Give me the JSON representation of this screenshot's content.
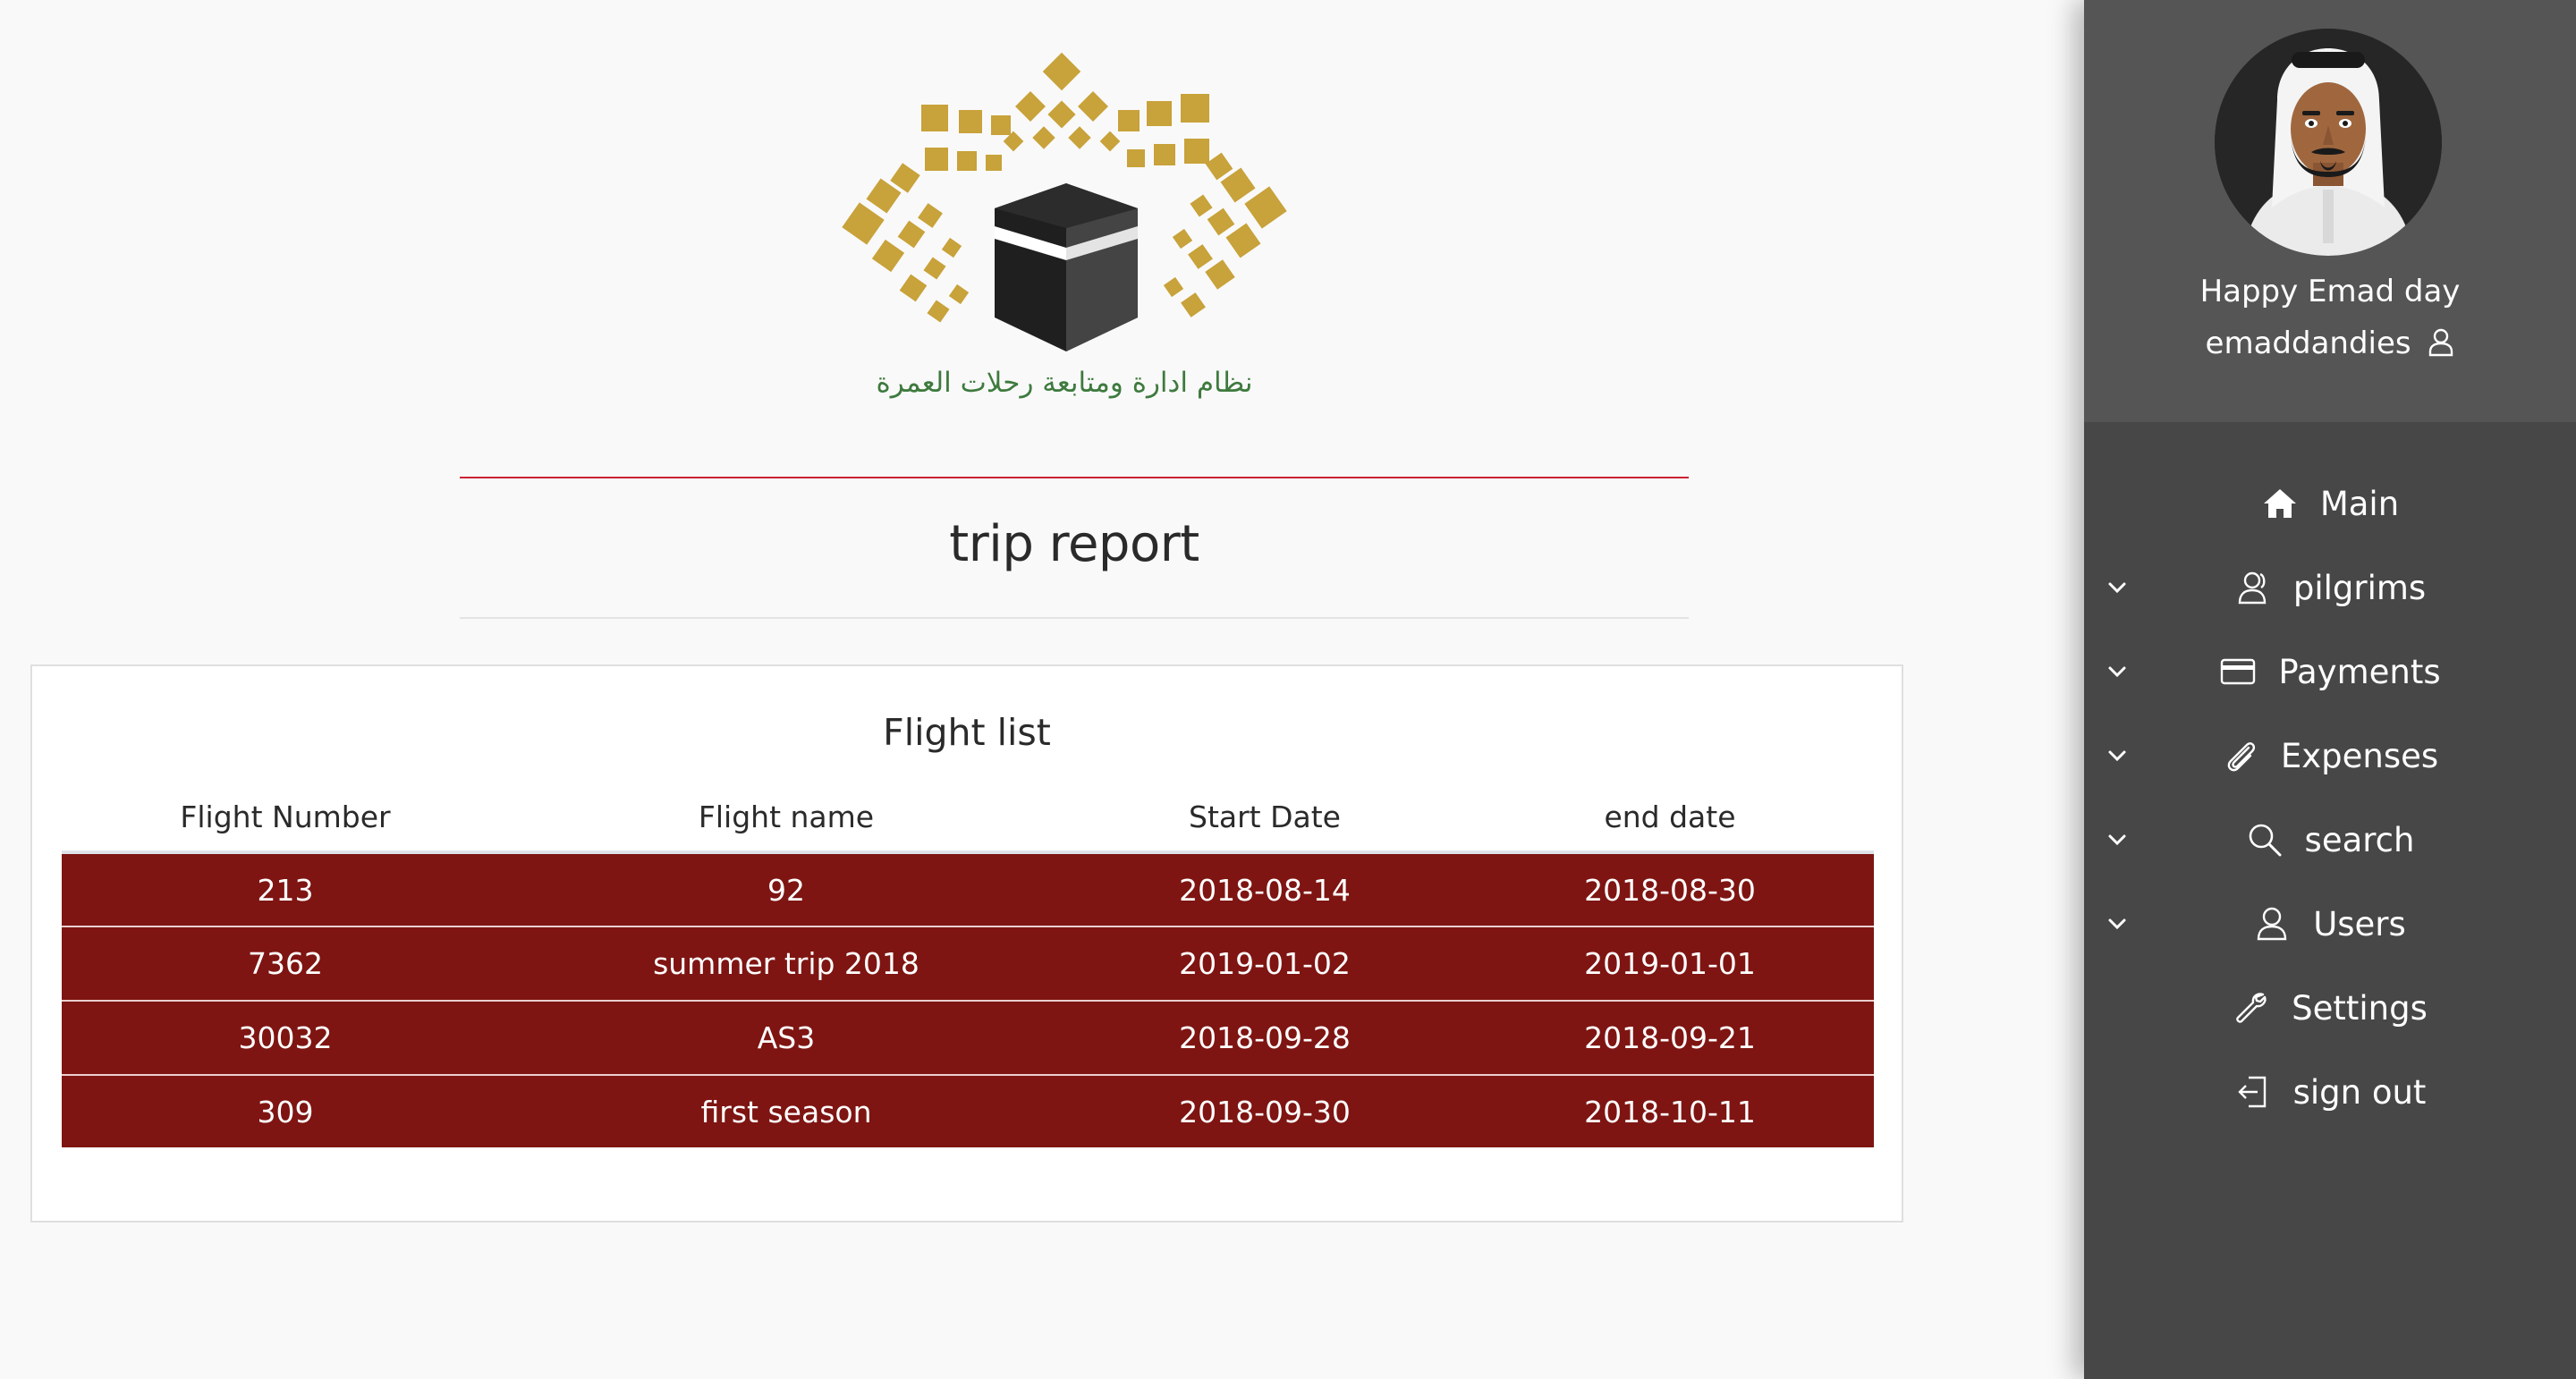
{
  "logo": {
    "caption": "نظام ادارة ومتابعة رحلات العمرة",
    "colors": {
      "gold": "#c8a23a",
      "kaaba_dark": "#1f1f1f",
      "kaaba_side": "#444444"
    }
  },
  "page": {
    "title": "trip report",
    "accent_rule_color": "#cc2233"
  },
  "flight_list": {
    "title": "Flight list",
    "columns": [
      "Flight Number",
      "Flight name",
      "Start Date",
      "end date"
    ],
    "rows": [
      [
        "213",
        "92",
        "2018-08-14",
        "2018-08-30"
      ],
      [
        "7362",
        "summer trip 2018",
        "2019-01-02",
        "2019-01-01"
      ],
      [
        "30032",
        "AS3",
        "2018-09-28",
        "2018-09-21"
      ],
      [
        "309",
        "first season",
        "2018-09-30",
        "2018-10-11"
      ]
    ],
    "row_color": "#7e1512"
  },
  "sidebar": {
    "greeting": "Happy Emad day",
    "username": "emaddandies",
    "nav": [
      {
        "label": "Main",
        "icon": "home-icon",
        "expandable": false
      },
      {
        "label": "pilgrims",
        "icon": "users-icon",
        "expandable": true
      },
      {
        "label": "Payments",
        "icon": "credit-card-icon",
        "expandable": true
      },
      {
        "label": "Expenses",
        "icon": "paperclip-icon",
        "expandable": true
      },
      {
        "label": "search",
        "icon": "search-icon",
        "expandable": true
      },
      {
        "label": "Users",
        "icon": "user-icon",
        "expandable": true
      },
      {
        "label": "Settings",
        "icon": "wrench-icon",
        "expandable": false
      },
      {
        "label": "sign out",
        "icon": "sign-out-icon",
        "expandable": false
      }
    ],
    "colors": {
      "background": "#474747",
      "profile_background": "#555555"
    }
  }
}
